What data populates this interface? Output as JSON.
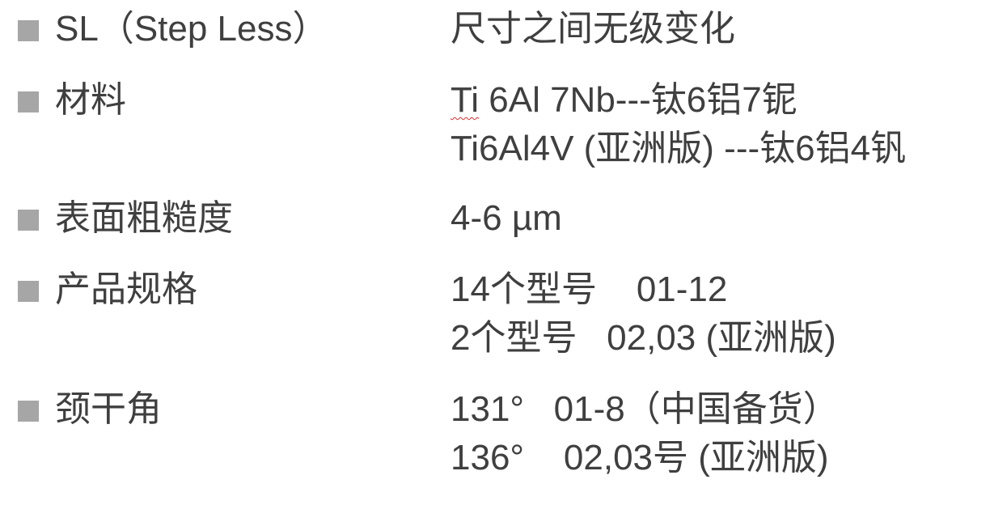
{
  "rows": [
    {
      "label": "SL（Step Less）",
      "values": [
        "尺寸之间无级变化"
      ]
    },
    {
      "label": "材料",
      "values": [
        {
          "flagged": "Ti",
          "rest": " 6Al 7Nb---钛6铝7铌"
        },
        "Ti6Al4V (亚洲版) ---钛6铝4钒"
      ]
    },
    {
      "label": "表面粗糙度",
      "values": [
        "4-6 µm"
      ]
    },
    {
      "label": "产品规格",
      "values": [
        "14个型号    01-12",
        "2个型号   02,03 (亚洲版)"
      ]
    },
    {
      "label": "颈干角",
      "values": [
        "131°   01-8（中国备货）",
        "136°    02,03号 (亚洲版)"
      ]
    }
  ]
}
